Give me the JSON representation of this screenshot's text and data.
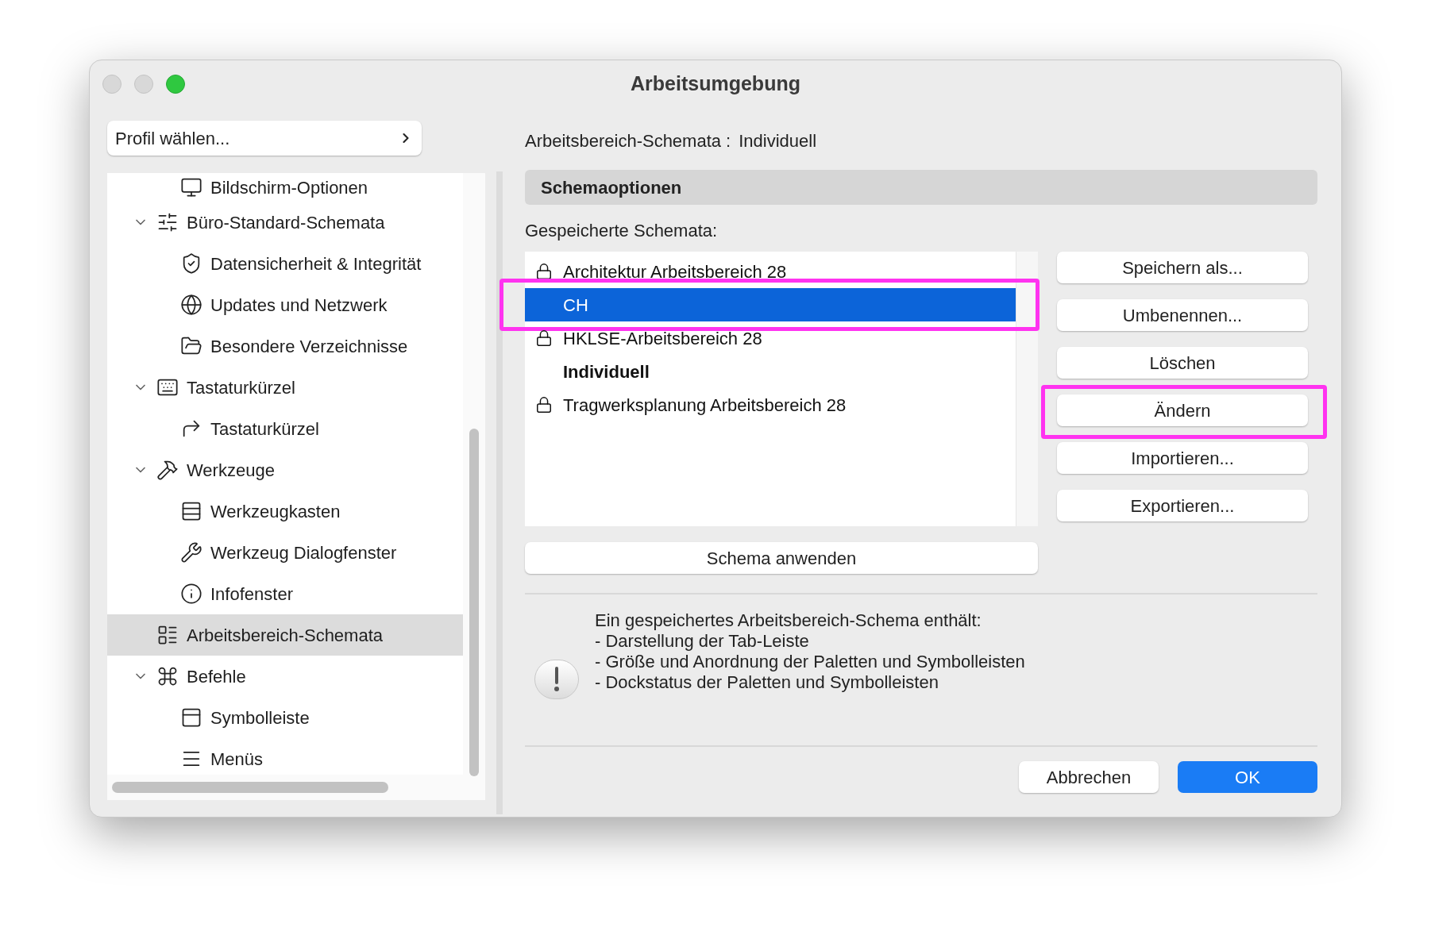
{
  "window": {
    "title": "Arbeitsumgebung"
  },
  "profile_button": {
    "label": "Profil wählen..."
  },
  "tree": [
    {
      "children": [
        {
          "label": "Bildschirm-Optionen",
          "selected": false
        }
      ]
    },
    {
      "label": "Büro-Standard-Schemata",
      "expanded": true,
      "selected": false,
      "children": [
        {
          "label": "Datensicherheit & Integrität",
          "selected": false
        },
        {
          "label": "Updates und Netzwerk",
          "selected": false
        },
        {
          "label": "Besondere Verzeichnisse",
          "selected": false
        }
      ]
    },
    {
      "label": "Tastaturkürzel",
      "expanded": true,
      "selected": false,
      "children": [
        {
          "label": "Tastaturkürzel",
          "selected": false
        }
      ]
    },
    {
      "label": "Werkzeuge",
      "expanded": true,
      "selected": false,
      "children": [
        {
          "label": "Werkzeugkasten",
          "selected": false
        },
        {
          "label": "Werkzeug Dialogfenster",
          "selected": false
        },
        {
          "label": "Infofenster",
          "selected": false
        }
      ]
    },
    {
      "label": "Arbeitsbereich-Schemata",
      "selected": true
    },
    {
      "label": "Befehle",
      "expanded": true,
      "selected": false,
      "children": [
        {
          "label": "Symbolleiste",
          "selected": false
        },
        {
          "label": "Menüs",
          "selected": false
        }
      ]
    }
  ],
  "header": {
    "label": "Arbeitsbereich-Schemata :",
    "value": "Individuell"
  },
  "section_title": "Schemaoptionen",
  "list_label": "Gespeicherte Schemata:",
  "schemes": [
    {
      "name": "Architektur Arbeitsbereich 28",
      "locked": true,
      "current": false,
      "selected": false,
      "highlighted": false
    },
    {
      "name": "CH",
      "locked": false,
      "current": false,
      "selected": true,
      "highlighted": true
    },
    {
      "name": "HKLSE-Arbeitsbereich 28",
      "locked": true,
      "current": false,
      "selected": false,
      "highlighted": false
    },
    {
      "name": "Individuell",
      "locked": false,
      "current": true,
      "selected": false,
      "highlighted": false
    },
    {
      "name": "Tragwerksplanung Arbeitsbereich 28",
      "locked": true,
      "current": false,
      "selected": false,
      "highlighted": false
    }
  ],
  "side_buttons": [
    {
      "label": "Speichern als...",
      "highlighted": false
    },
    {
      "label": "Umbenennen...",
      "highlighted": false
    },
    {
      "label": "Löschen",
      "highlighted": false
    },
    {
      "label": "Ändern",
      "highlighted": true
    },
    {
      "label": "Importieren...",
      "highlighted": false
    },
    {
      "label": "Exportieren...",
      "highlighted": false
    }
  ],
  "apply_button": "Schema anwenden",
  "info_lines": [
    "Ein gespeichertes Arbeitsbereich-Schema enthält:",
    "- Darstellung der Tab-Leiste",
    "- Größe und Anordnung der Paletten und Symbolleisten",
    "- Dockstatus der Paletten und Symbolleisten"
  ],
  "footer_buttons": [
    {
      "label": "Abbrechen",
      "kind": "cancel"
    },
    {
      "label": "OK",
      "kind": "default"
    }
  ]
}
